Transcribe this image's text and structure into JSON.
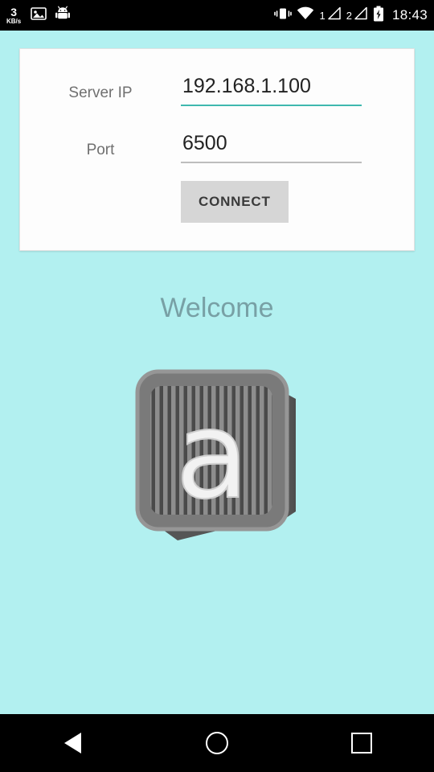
{
  "statusbar": {
    "netspeed_value": "3",
    "netspeed_unit": "KB/s",
    "icons": [
      "photo-icon",
      "android-robot-icon",
      "vibrate-icon",
      "wifi-icon",
      "signal-icon",
      "signal-icon",
      "battery-charging-icon"
    ],
    "sim1_label": "1",
    "sim2_label": "2",
    "clock": "18:43"
  },
  "form": {
    "server_ip_label": "Server IP",
    "server_ip_value": "192.168.1.100",
    "server_ip_placeholder": "Server IP",
    "port_label": "Port",
    "port_value": "6500",
    "port_placeholder": "Port",
    "connect_label": "CONNECT"
  },
  "content": {
    "welcome_text": "Welcome",
    "logo_name": "app-logo-letter-a",
    "logo_letter": "a"
  },
  "navbar": {
    "back_label": "Back",
    "home_label": "Home",
    "recent_label": "Recent apps"
  },
  "colors": {
    "background": "#b2f0f0",
    "card": "#fdfdfd",
    "accent_underline": "#3fb8af",
    "welcome_text": "#78a0a5",
    "button": "#d6d6d6"
  }
}
